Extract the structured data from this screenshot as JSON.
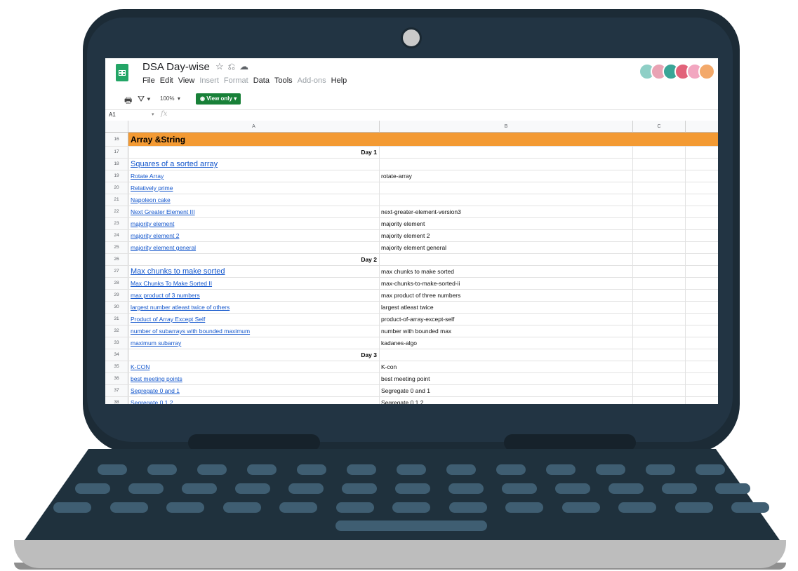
{
  "app": {
    "doc_title": "DSA Day-wise",
    "title_icons": [
      "star-icon",
      "drive-move-icon",
      "cloud-status-icon"
    ],
    "menu": [
      "File",
      "Edit",
      "View",
      "Insert",
      "Format",
      "Data",
      "Tools",
      "Add-ons",
      "Help"
    ],
    "menu_disabled": [
      "Insert",
      "Format",
      "Add-ons"
    ]
  },
  "toolbar": {
    "print_icon": "print-icon",
    "filter_icon": "filter-icon",
    "zoom": "100%",
    "view_only_label": "View only"
  },
  "formula_bar": {
    "cell_ref": "A1",
    "fx_label": "fx"
  },
  "columns": [
    "A",
    "B",
    "C"
  ],
  "section_header": {
    "row": "16",
    "text": "Array &String",
    "color": "#f39a33"
  },
  "rows": [
    {
      "n": "17",
      "a": "Day 1",
      "b": "",
      "kind": "day"
    },
    {
      "n": "18",
      "a": "Squares of a sorted array",
      "b": "",
      "kind": "link-big"
    },
    {
      "n": "19",
      "a": "Rotate Array",
      "b": "rotate-array",
      "kind": "link"
    },
    {
      "n": "20",
      "a": "Relatively prime",
      "b": "",
      "kind": "link"
    },
    {
      "n": "21",
      "a": "Napoleon cake",
      "b": "",
      "kind": "link"
    },
    {
      "n": "22",
      "a": "Next Greater Element III",
      "b": "next-greater-element-version3",
      "kind": "link"
    },
    {
      "n": "23",
      "a": "majority element",
      "b": "majority element",
      "kind": "link"
    },
    {
      "n": "24",
      "a": "majority element 2",
      "b": "majority element 2",
      "kind": "link"
    },
    {
      "n": "25",
      "a": "majority element general",
      "b": "majority element general",
      "kind": "link"
    },
    {
      "n": "26",
      "a": "Day 2",
      "b": "",
      "kind": "day"
    },
    {
      "n": "27",
      "a": "Max chunks to make sorted",
      "b": "max chunks to make sorted",
      "kind": "link-big"
    },
    {
      "n": "28",
      "a": "Max Chunks To Make Sorted II",
      "b": "max-chunks-to-make-sorted-ii",
      "kind": "link"
    },
    {
      "n": "29",
      "a": "max product of 3 numbers",
      "b": "max product of three numbers",
      "kind": "link"
    },
    {
      "n": "30",
      "a": "largest number atleast twice of others",
      "b": "largest atleast twice",
      "kind": "link"
    },
    {
      "n": "31",
      "a": "Product of Array Except Self",
      "b": "product-of-array-except-self",
      "kind": "link"
    },
    {
      "n": "32",
      "a": "number of subarrays with bounded maximum",
      "b": "number with bounded max",
      "kind": "link"
    },
    {
      "n": "33",
      "a": "maximum subarray",
      "b": "kadanes-algo",
      "kind": "link"
    },
    {
      "n": "34",
      "a": "Day 3",
      "b": "",
      "kind": "day"
    },
    {
      "n": "35",
      "a": "K-CON",
      "b": "K-con",
      "kind": "link"
    },
    {
      "n": "36",
      "a": "best meeting points",
      "b": "best meeting point",
      "kind": "link"
    },
    {
      "n": "37",
      "a": "Segregate 0 and 1",
      "b": "Segregate 0 and 1",
      "kind": "link"
    },
    {
      "n": "38",
      "a": "Segregate 0 1 2",
      "b": "Segregate 0 1 2",
      "kind": "link"
    }
  ],
  "avatar_colors": [
    "#8fcfc6",
    "#e9a3b4",
    "#3aa597",
    "#e2627a",
    "#f2a6c0",
    "#f3a96a"
  ]
}
